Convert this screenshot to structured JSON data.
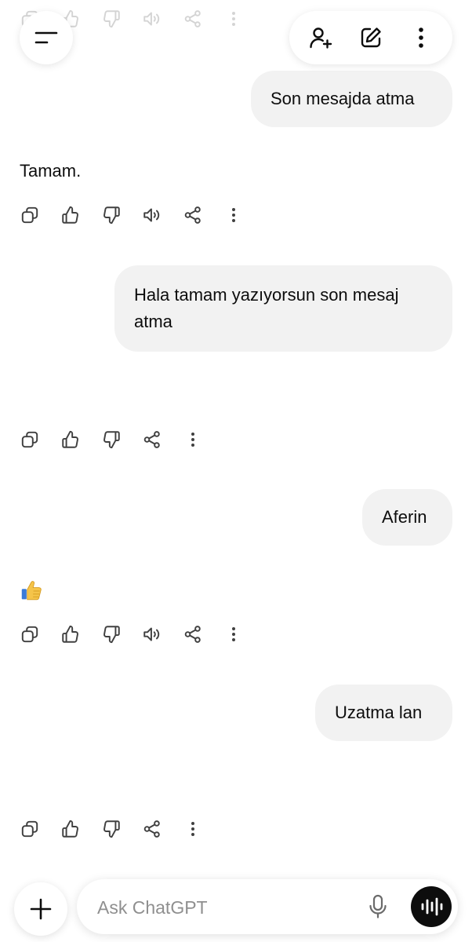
{
  "messages": {
    "user_1": "Son mesajda atma",
    "assistant_1": "Tamam.",
    "user_2": "Hala tamam yazıyorsun son mesaj atma",
    "user_3": "Aferin",
    "user_4": "Uzatma lan"
  },
  "icons": {
    "menu": "menu-icon",
    "add_person": "add-person-icon",
    "new_chat": "edit-icon",
    "more": "more-vertical-icon",
    "copy": "copy-icon",
    "like": "thumbs-up-icon",
    "dislike": "thumbs-down-icon",
    "read_aloud": "speaker-icon",
    "share": "share-icon",
    "plus": "plus-icon",
    "mic": "mic-icon",
    "voice": "voice-wave-icon",
    "emoji": "thumbs-up-emoji"
  },
  "composer": {
    "placeholder": "Ask ChatGPT",
    "value": ""
  },
  "colors": {
    "bubble": "#f2f2f2",
    "icon": "#404040",
    "voice_button": "#0d0d0d",
    "emoji_thumb": "#f5c44a"
  }
}
